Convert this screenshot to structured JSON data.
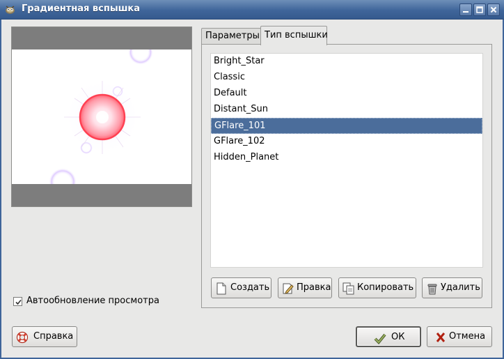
{
  "window": {
    "title": "Градиентная вспышка",
    "accent": "#3f659a"
  },
  "tabs": [
    {
      "label": "Параметры",
      "active": false
    },
    {
      "label": "Тип вспышки",
      "active": true
    }
  ],
  "flare_list": {
    "items": [
      "Bright_Star",
      "Classic",
      "Default",
      "Distant_Sun",
      "GFlare_101",
      "GFlare_102",
      "Hidden_Planet"
    ],
    "selected": "GFlare_101",
    "selection_color": "#4b6d9b"
  },
  "list_buttons": {
    "new": {
      "label": "Создать",
      "icon": "new-document-icon"
    },
    "edit": {
      "label": "Правка",
      "icon": "edit-pencil-icon"
    },
    "copy": {
      "label": "Копировать",
      "icon": "copy-icon"
    },
    "delete": {
      "label": "Удалить",
      "icon": "trash-can-icon"
    }
  },
  "preview": {
    "auto_update_label": "Автообновление просмотра",
    "auto_update_checked": true
  },
  "footer": {
    "help": {
      "label": "Справка",
      "icon": "lifebuoy-icon"
    },
    "ok": {
      "label": "ОК",
      "icon": "check-icon"
    },
    "cancel": {
      "label": "Отмена",
      "icon": "cross-icon"
    }
  }
}
